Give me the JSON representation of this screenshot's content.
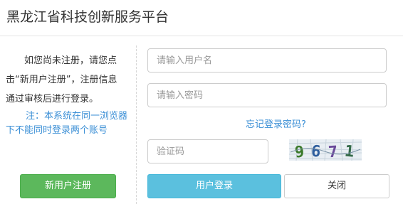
{
  "dialog": {
    "title": "黑龙江省科技创新服务平台"
  },
  "left": {
    "notice_line1": "如您尚未注册，请您",
    "notice_rest": "点击“新用户注册”，注册信息通过审核后进行登录。",
    "warning_line1": "注：本系统在同一浏",
    "warning_rest": "览器下不能同时登录两个账号",
    "register_button": "新用户注册"
  },
  "form": {
    "username_placeholder": "请输入用户名",
    "password_placeholder": "请输入密码",
    "forgot_link": "忘记登录密码?",
    "captcha_placeholder": "验证码",
    "captcha_text": "9671",
    "login_button": "用户登录",
    "close_button": "关闭"
  },
  "colors": {
    "register_button": "#5cb85c",
    "login_button": "#5bc0de",
    "link": "#3b8fd6"
  }
}
